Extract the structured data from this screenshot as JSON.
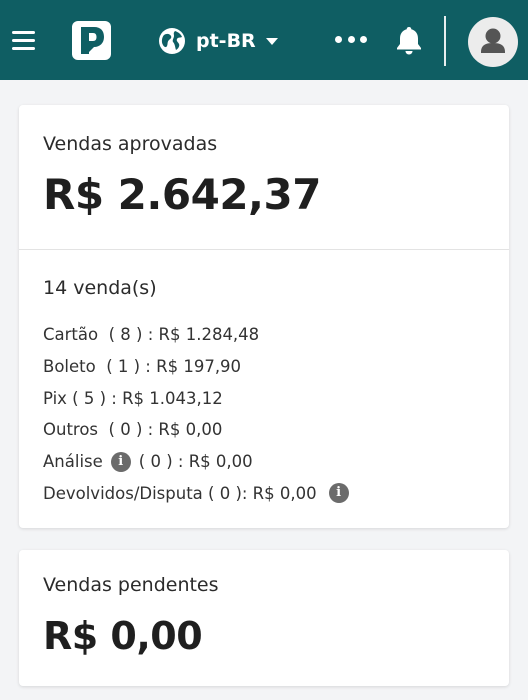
{
  "header": {
    "language": "pt-BR",
    "icons": {
      "menu": "hamburger-icon",
      "logo": "brand-logo",
      "language": "globe-icon",
      "more": "more-icon",
      "notifications": "bell-icon",
      "profile": "user-icon"
    },
    "colors": {
      "bar": "#0f5e63"
    }
  },
  "approved": {
    "title": "Vendas aprovadas",
    "amount": "R$ 2.642,37",
    "sales_count": "14 venda(s)",
    "lines": {
      "card": "Cartão  ( 8 ) : R$ 1.284,48",
      "boleto": "Boleto  ( 1 ) : R$ 197,90",
      "pix": "Pix ( 5 ) : R$ 1.043,12",
      "others": "Outros  ( 0 ) : R$ 0,00",
      "analysis_label": "Análise",
      "analysis_value": "( 0 ) : R$ 0,00",
      "refunded": "Devolvidos/Disputa ( 0 ): R$ 0,00"
    },
    "info_glyph": "i"
  },
  "pending": {
    "title": "Vendas pendentes",
    "amount": "R$ 0,00"
  }
}
